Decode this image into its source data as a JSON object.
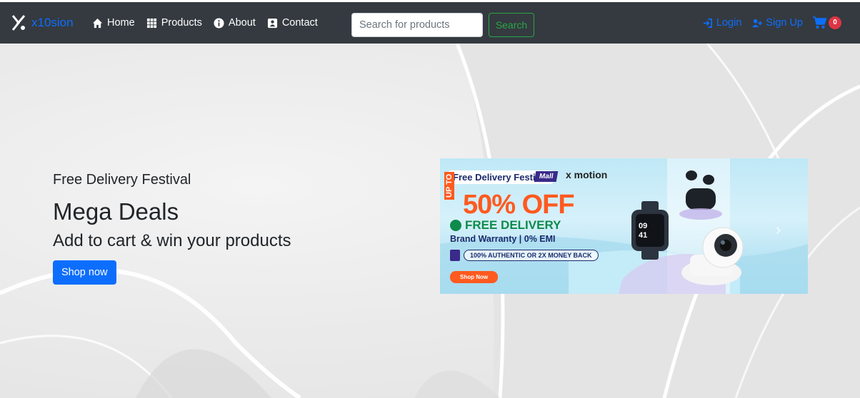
{
  "brand": {
    "name": "x10sion"
  },
  "nav": {
    "links": [
      {
        "label": "Home",
        "icon": "home-icon"
      },
      {
        "label": "Products",
        "icon": "grid-icon"
      },
      {
        "label": "About",
        "icon": "info-icon"
      },
      {
        "label": "Contact",
        "icon": "contact-card-icon"
      }
    ],
    "search": {
      "placeholder": "Search for products",
      "value": "",
      "button": "Search"
    },
    "login": "Login",
    "signup": "Sign Up",
    "cart_count": "0"
  },
  "hero": {
    "subtitle": "Free Delivery Festival",
    "title": "Mega Deals",
    "tagline": "Add to cart & win your products",
    "button": "Shop now"
  },
  "banner": {
    "festival": "Free Delivery Festival",
    "mall": "Mall",
    "brand": "x motion",
    "upto": "UP TO",
    "discount": "50% OFF",
    "delivery": "FREE DELIVERY",
    "warranty": "Brand Warranty | 0% EMI",
    "authentic": "100% AUTHENTIC OR 2X MONEY BACK",
    "shop": "Shop Now"
  },
  "colors": {
    "navbar": "#343a40",
    "brand": "#0d6efd",
    "search_button": "#28a745",
    "primary": "#0d6efd",
    "badge": "#dc3545",
    "offer": "#ff5a1f"
  }
}
